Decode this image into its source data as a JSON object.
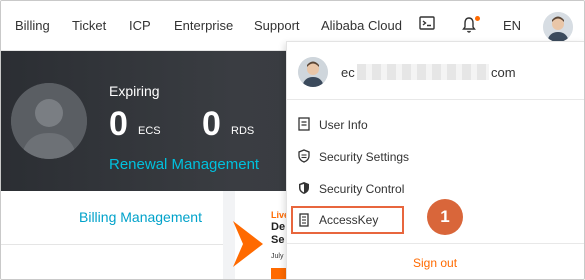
{
  "nav": {
    "items": [
      "Billing",
      "Ticket",
      "ICP",
      "Enterprise",
      "Support",
      "Alibaba Cloud"
    ],
    "terminal_icon": "terminal-icon",
    "bell_icon": "bell-icon",
    "language": "EN",
    "avatar_icon": "user-avatar-icon"
  },
  "banner": {
    "expiring_label": "Expiring",
    "ecs_count": "0",
    "ecs_label": "ECS",
    "rds_count": "0",
    "rds_label": "RDS",
    "renewal_link": "Renewal Management"
  },
  "billing_management_link": "Billing Management",
  "promo": {
    "live": "Live",
    "line1": "De",
    "line2": "Se",
    "date": "July"
  },
  "dropdown": {
    "email_prefix": "ec",
    "email_suffix": "com",
    "items": [
      {
        "label": "User Info",
        "icon": "document-icon"
      },
      {
        "label": "Security Settings",
        "icon": "shield-icon"
      },
      {
        "label": "Security Control",
        "icon": "shield-check-icon"
      },
      {
        "label": "AccessKey",
        "icon": "key-icon"
      }
    ],
    "callout": "1",
    "sign_out": "Sign out"
  },
  "colors": {
    "accent_orange": "#ff6a00",
    "link_blue": "#00c1de",
    "highlight_box": "#e8663d",
    "banner_bg": "#2e3237"
  }
}
